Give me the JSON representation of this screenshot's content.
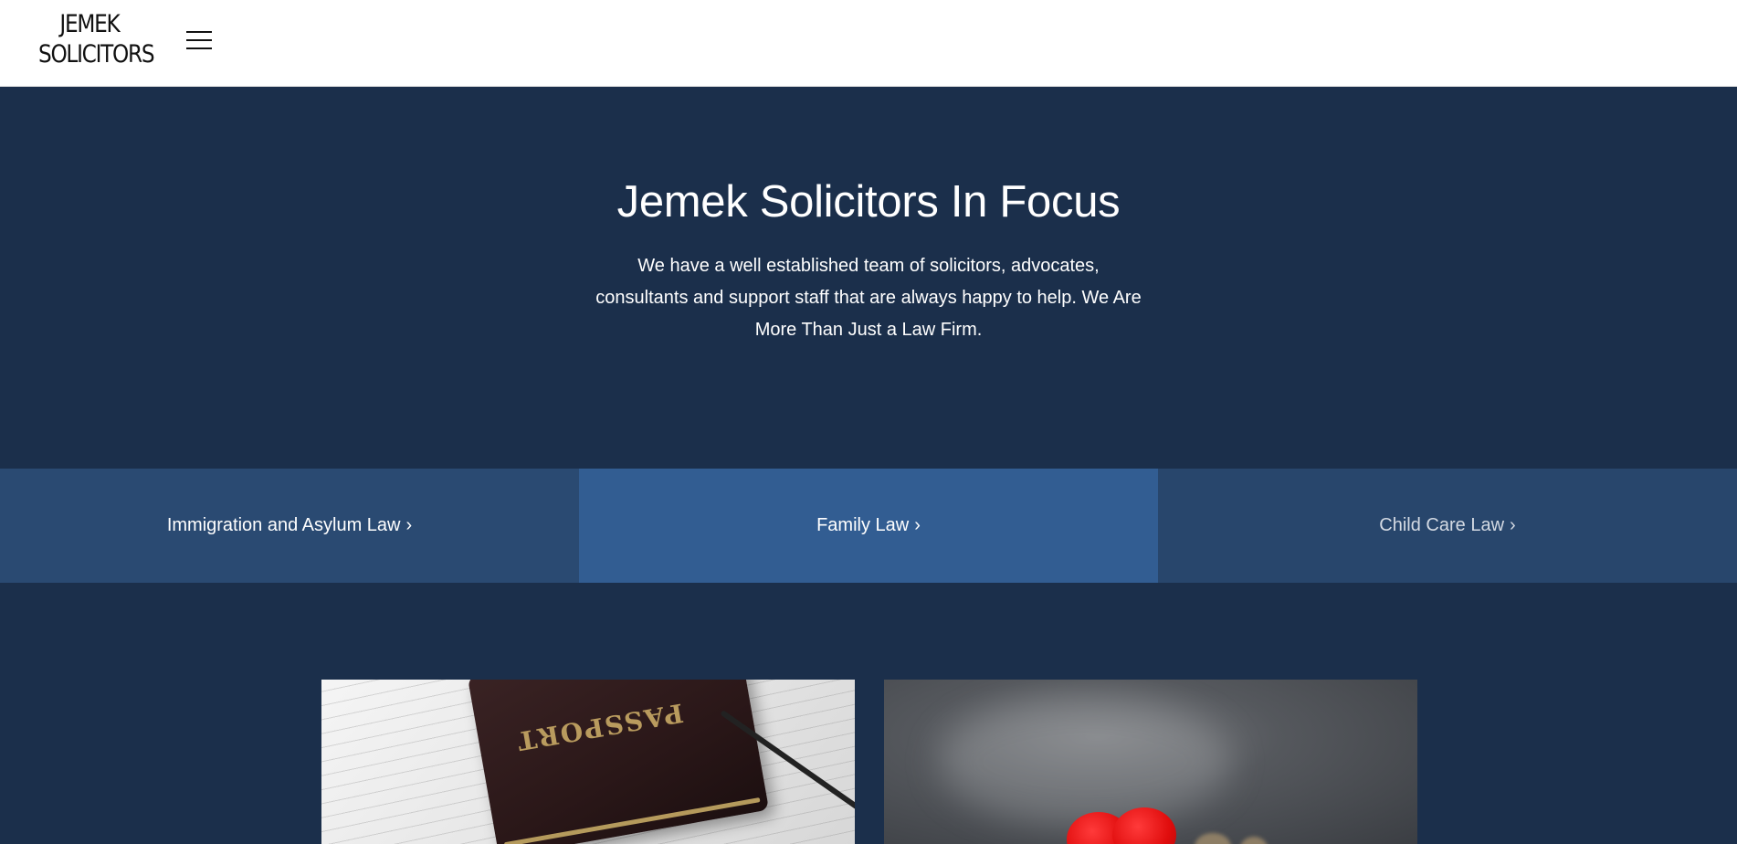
{
  "header": {
    "logo_line1": "JEMEK",
    "logo_line2": "SOLICITORS",
    "menu_icon": "hamburger-menu-icon"
  },
  "hero": {
    "title": "Jemek Solicitors In Focus",
    "text": "We have a well established team of solicitors, advocates, consultants and support staff that are always happy to help. We Are More Than Just a Law Firm."
  },
  "tabs": [
    {
      "label": "Immigration and Asylum Law",
      "chevron": "›"
    },
    {
      "label": "Family Law",
      "chevron": "›"
    },
    {
      "label": "Child Care Law",
      "chevron": "›"
    }
  ],
  "cards": [
    {
      "image": "passport-photo",
      "image_text": "PASSPORT"
    },
    {
      "image": "red-heart-photo"
    }
  ],
  "colors": {
    "header_bg": "#ffffff",
    "page_bg": "#1b2f4b",
    "tab_1": "#2a4a72",
    "tab_2_active": "#325d92",
    "tab_3": "#28466c",
    "text_light": "#ffffff"
  }
}
